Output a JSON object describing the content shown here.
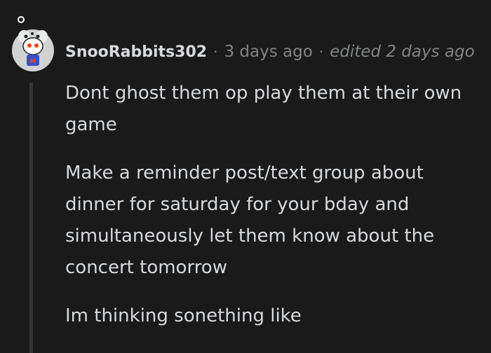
{
  "comment": {
    "author": "SnooRabbits302",
    "separator": "·",
    "timestamp": "3 days ago",
    "edited": "edited 2 days ago",
    "paragraphs": [
      "Dont ghost them op play them at their own game",
      "Make a reminder post/text group about dinner for saturday for your bday and simultaneously let them know about the concert tomorrow",
      "Im thinking sonething like"
    ]
  },
  "colors": {
    "background": "#1a1a1b",
    "text": "#d7dadc",
    "meta": "#818384",
    "thread_line": "#343536"
  }
}
